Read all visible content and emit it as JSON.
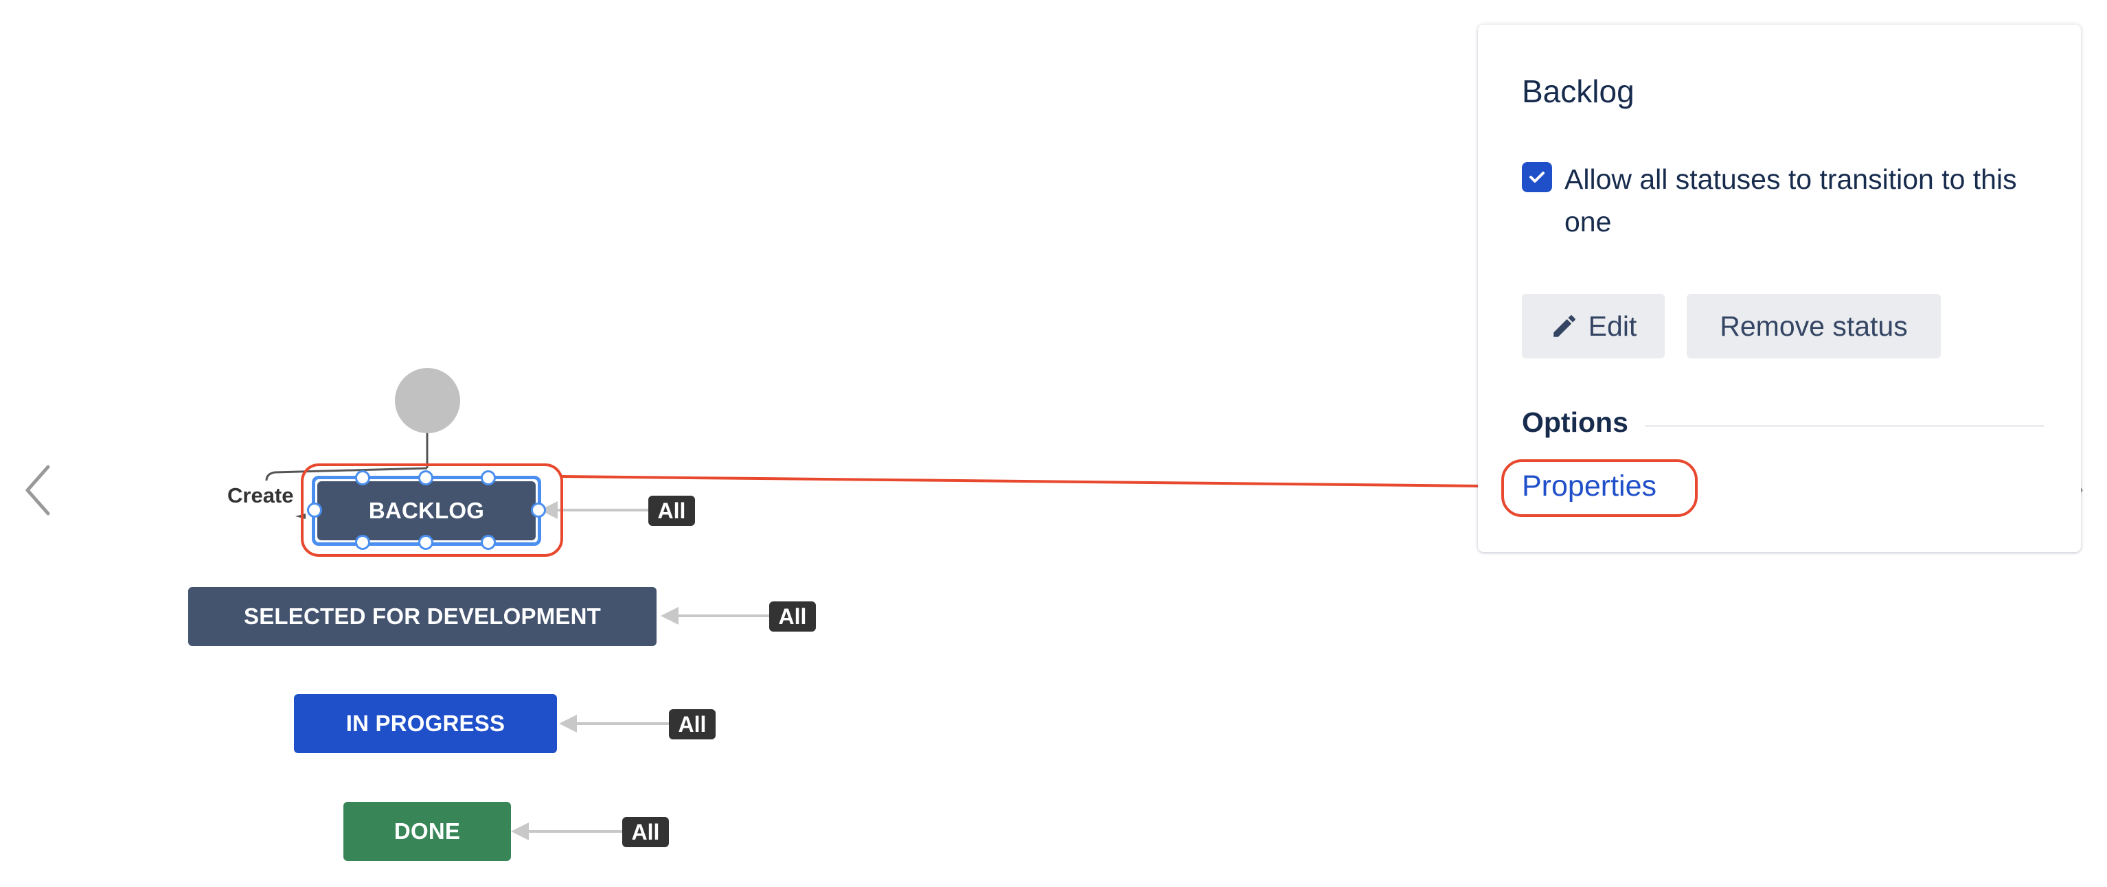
{
  "workflow": {
    "create_label": "Create",
    "statuses": [
      {
        "id": "backlog",
        "label": "BACKLOG",
        "color": "#44546f",
        "selected": true,
        "transition_badge": "All"
      },
      {
        "id": "selected-for-development",
        "label": "SELECTED FOR DEVELOPMENT",
        "color": "#44546f",
        "selected": false,
        "transition_badge": "All"
      },
      {
        "id": "in-progress",
        "label": "IN PROGRESS",
        "color": "#1f50c9",
        "selected": false,
        "transition_badge": "All"
      },
      {
        "id": "done",
        "label": "DONE",
        "color": "#388658",
        "selected": false,
        "transition_badge": "All"
      }
    ]
  },
  "navigation": {
    "prev_icon": "chevron-left-icon",
    "next_icon": "chevron-right-icon"
  },
  "panel": {
    "title": "Backlog",
    "allow_all_checkbox": {
      "checked": true,
      "label": "Allow all statuses to transition to this one"
    },
    "edit_button": {
      "label": "Edit",
      "icon": "pencil-icon"
    },
    "remove_button": {
      "label": "Remove status"
    },
    "options_heading": "Options",
    "properties_link": "Properties"
  },
  "annotation": {
    "highlight_color": "#e8492e"
  }
}
